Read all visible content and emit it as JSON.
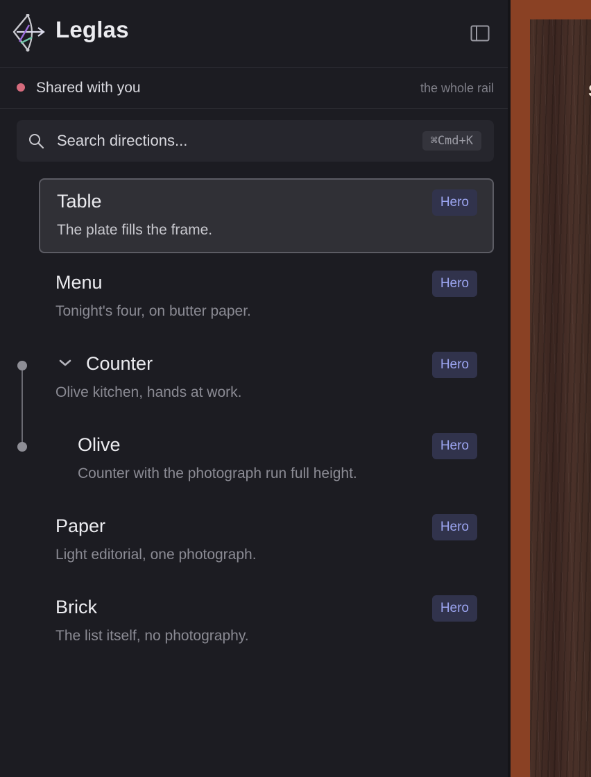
{
  "app": {
    "title": "Leglas"
  },
  "shared": {
    "label": "Shared with you",
    "scope": "the whole rail",
    "dot_color": "#d66b7d"
  },
  "search": {
    "placeholder": "Search directions...",
    "shortcut": "⌘Cmd+K"
  },
  "items": [
    {
      "title": "Table",
      "desc": "The plate fills the frame.",
      "badge": "Hero",
      "selected": true
    },
    {
      "title": "Menu",
      "desc": "Tonight's four, on butter paper.",
      "badge": "Hero"
    },
    {
      "title": "Counter",
      "desc": "Olive kitchen, hands at work.",
      "badge": "Hero",
      "expanded": true
    },
    {
      "title": "Olive",
      "desc": "Counter with the photograph run full height.",
      "badge": "Hero",
      "child_of": "Counter"
    },
    {
      "title": "Paper",
      "desc": "Light editorial, one photograph.",
      "badge": "Hero"
    },
    {
      "title": "Brick",
      "desc": "The list itself, no photography.",
      "badge": "Hero"
    }
  ],
  "preview": {
    "edge_glyph": "S"
  },
  "colors": {
    "accent_badge": "#9da6f2",
    "preview_frame": "#8a4124",
    "background": "#1c1c22"
  },
  "icons": {
    "logo": "bow-arrow-logo-icon",
    "toggle": "sidebar-toggle-icon",
    "search": "search-icon",
    "chevron": "chevron-down-icon"
  }
}
